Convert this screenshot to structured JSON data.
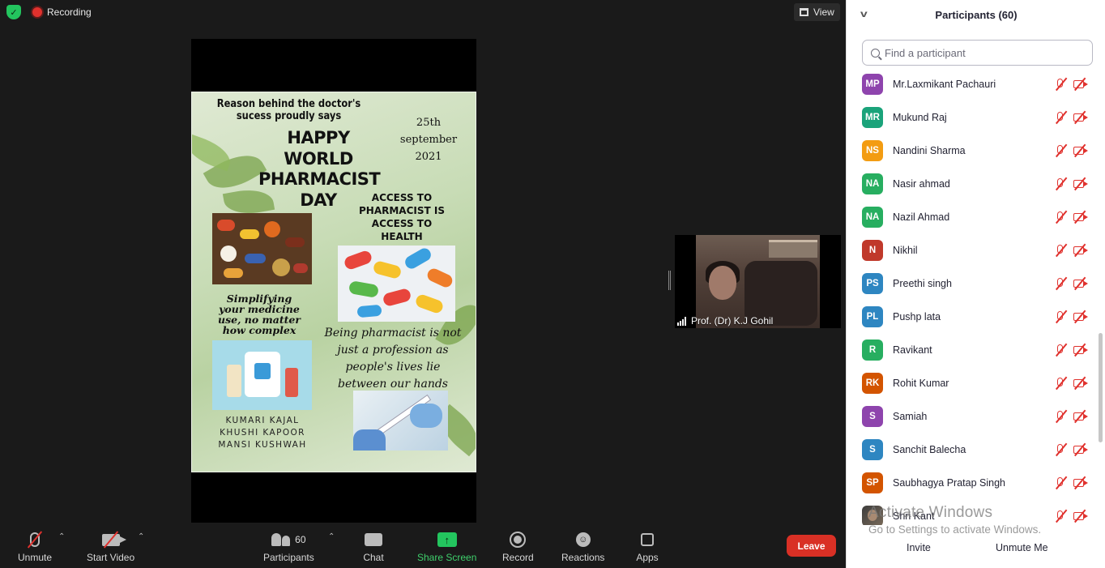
{
  "top": {
    "recording_label": "Recording",
    "view_label": "View"
  },
  "share": {
    "poster": {
      "title": "Reason behind the doctor's sucess proudly says",
      "date_lines": [
        "25th",
        "september",
        "2021"
      ],
      "headline_lines": [
        "HAPPY",
        "WORLD",
        "PHARMACIST",
        "DAY"
      ],
      "access_lines": [
        "ACCESS TO",
        "PHARMACIST IS",
        "ACCESS TO",
        "HEALTH"
      ],
      "simplify_lines": [
        "Simplifying",
        "your medicine",
        "use, no matter",
        "how complex"
      ],
      "being_lines": [
        "Being pharmacist is not",
        "just a profession as",
        "people's lives lie",
        "between our hands"
      ],
      "names": [
        "KUMARI KAJAL",
        "KHUSHI KAPOOR",
        "MANSI KUSHWAH"
      ]
    }
  },
  "thumbnail": {
    "name": "Prof. (Dr) K.J Gohil"
  },
  "toolbar": {
    "unmute": "Unmute",
    "start_video": "Start Video",
    "participants": "Participants",
    "participants_count": "60",
    "chat": "Chat",
    "share_screen": "Share Screen",
    "record": "Record",
    "reactions": "Reactions",
    "apps": "Apps",
    "leave": "Leave"
  },
  "panel": {
    "title": "Participants (60)",
    "search_placeholder": "Find a participant",
    "participants": [
      {
        "initials": "MP",
        "name": "Mr.Laxmikant Pachauri",
        "color": "#8e44ad"
      },
      {
        "initials": "MR",
        "name": "Mukund Raj",
        "color": "#1aa37a"
      },
      {
        "initials": "NS",
        "name": "Nandini Sharma",
        "color": "#f39c12"
      },
      {
        "initials": "NA",
        "name": "Nasir ahmad",
        "color": "#27ae60"
      },
      {
        "initials": "NA",
        "name": "Nazil Ahmad",
        "color": "#27ae60"
      },
      {
        "initials": "N",
        "name": "Nikhil",
        "color": "#c0392b"
      },
      {
        "initials": "PS",
        "name": "Preethi singh",
        "color": "#2e86c1"
      },
      {
        "initials": "PL",
        "name": "Pushp lata",
        "color": "#2e86c1"
      },
      {
        "initials": "R",
        "name": "Ravikant",
        "color": "#27ae60"
      },
      {
        "initials": "RK",
        "name": "Rohit Kumar",
        "color": "#d35400"
      },
      {
        "initials": "S",
        "name": "Samiah",
        "color": "#8e44ad"
      },
      {
        "initials": "S",
        "name": "Sanchit Balecha",
        "color": "#2e86c1"
      },
      {
        "initials": "SP",
        "name": "Saubhagya Pratap Singh",
        "color": "#d35400"
      },
      {
        "initials": "",
        "name": "Shri Kant",
        "color": "#555555"
      }
    ],
    "watermark_line1": "Activate Windows",
    "watermark_line2": "Go to Settings to activate Windows.",
    "invite": "Invite",
    "unmute_me": "Unmute Me"
  }
}
